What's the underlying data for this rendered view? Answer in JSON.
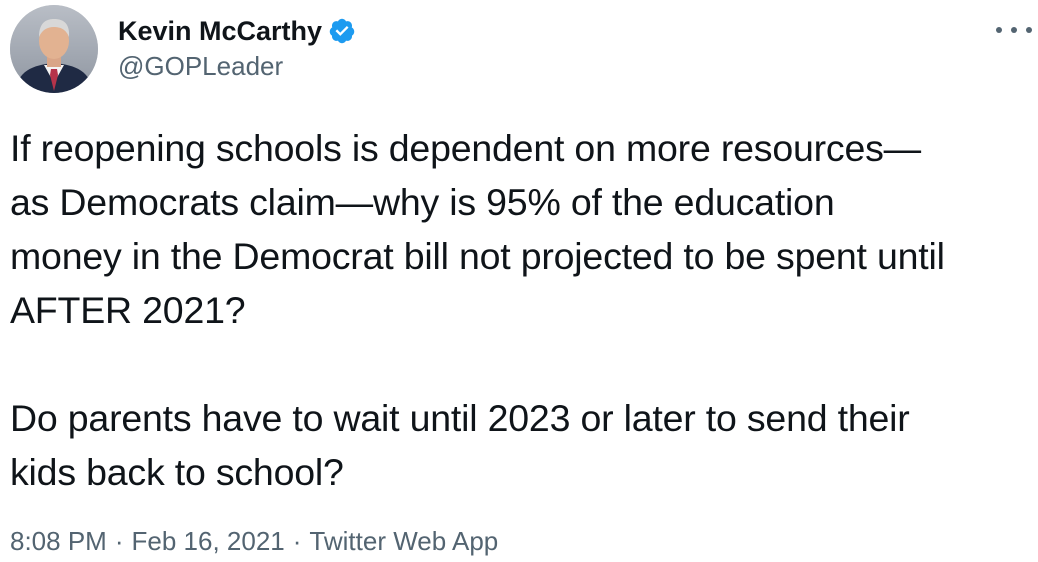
{
  "author": {
    "display_name": "Kevin McCarthy",
    "handle": "@GOPLeader",
    "verified": true,
    "avatar_icon": "profile-photo",
    "verified_icon": "verified-badge-icon",
    "verified_color": "#1d9bf0"
  },
  "menu": {
    "icon": "more-options-icon"
  },
  "tweet": {
    "paragraphs": [
      "If reopening schools is dependent on more resources—\nas Democrats claim—why is 95% of the education\nmoney in the Democrat bill not projected to be spent until\nAFTER 2021?",
      "Do parents have to wait until 2023 or later to send their\nkids back to school?"
    ]
  },
  "meta": {
    "time": "8:08 PM",
    "separator_1": "·",
    "date": "Feb 16, 2021",
    "separator_2": "·",
    "source": "Twitter Web App"
  },
  "colors": {
    "text_primary": "#0f1419",
    "text_secondary": "#536471",
    "background": "#ffffff"
  }
}
